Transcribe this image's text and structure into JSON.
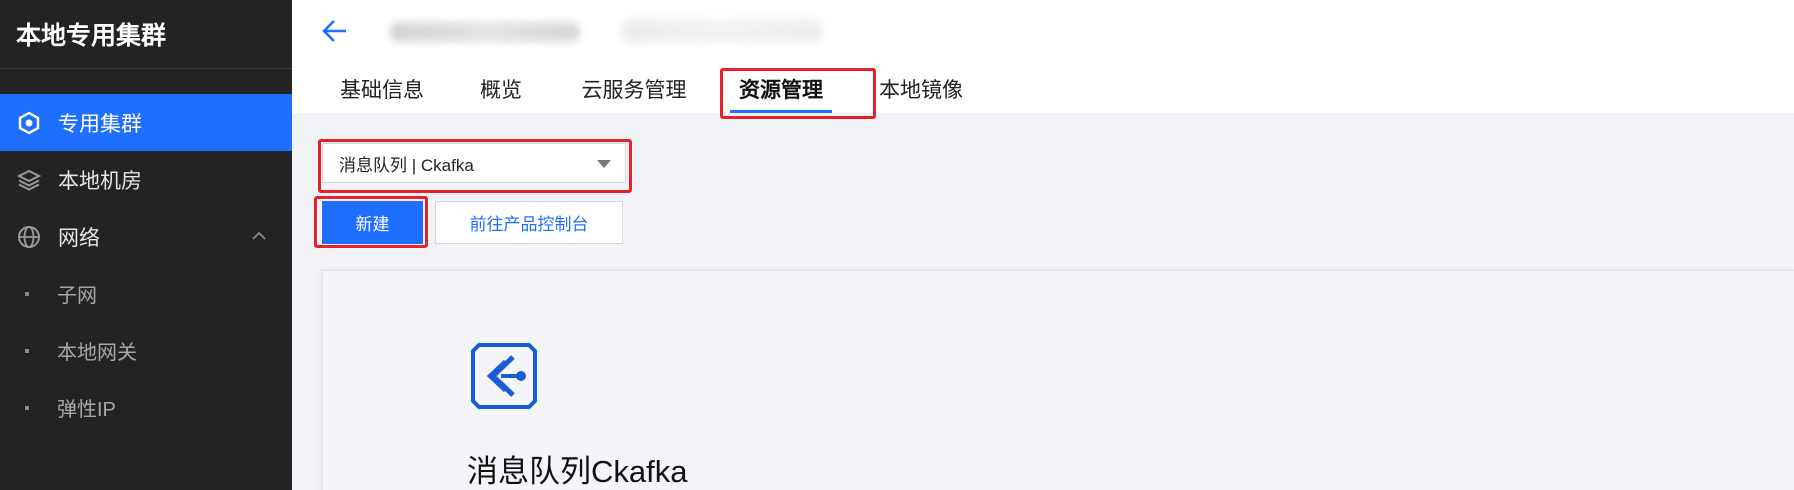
{
  "sidebar": {
    "title": "本地专用集群",
    "items": [
      {
        "label": "专用集群",
        "icon": "cluster-icon",
        "active": true
      },
      {
        "label": "本地机房",
        "icon": "layers-icon",
        "active": false
      },
      {
        "label": "网络",
        "icon": "globe-icon",
        "active": false,
        "expanded": true
      }
    ],
    "sub_items": [
      {
        "label": "子网"
      },
      {
        "label": "本地网关"
      },
      {
        "label": "弹性IP"
      }
    ]
  },
  "header": {
    "tabs": [
      {
        "label": "基础信息"
      },
      {
        "label": "概览"
      },
      {
        "label": "云服务管理"
      },
      {
        "label": "资源管理"
      },
      {
        "label": "本地镜像"
      }
    ],
    "active_tab": "资源管理"
  },
  "content": {
    "service_select": {
      "value": "消息队列 | Ckafka"
    },
    "new_button": "新建",
    "console_button": "前往产品控制台",
    "product": {
      "name": "消息队列Ckafka",
      "icon": "ckafka-icon"
    }
  },
  "colors": {
    "accent": "#1f6fff",
    "sidebar_bg": "#232323",
    "highlight": "#e8202a"
  }
}
